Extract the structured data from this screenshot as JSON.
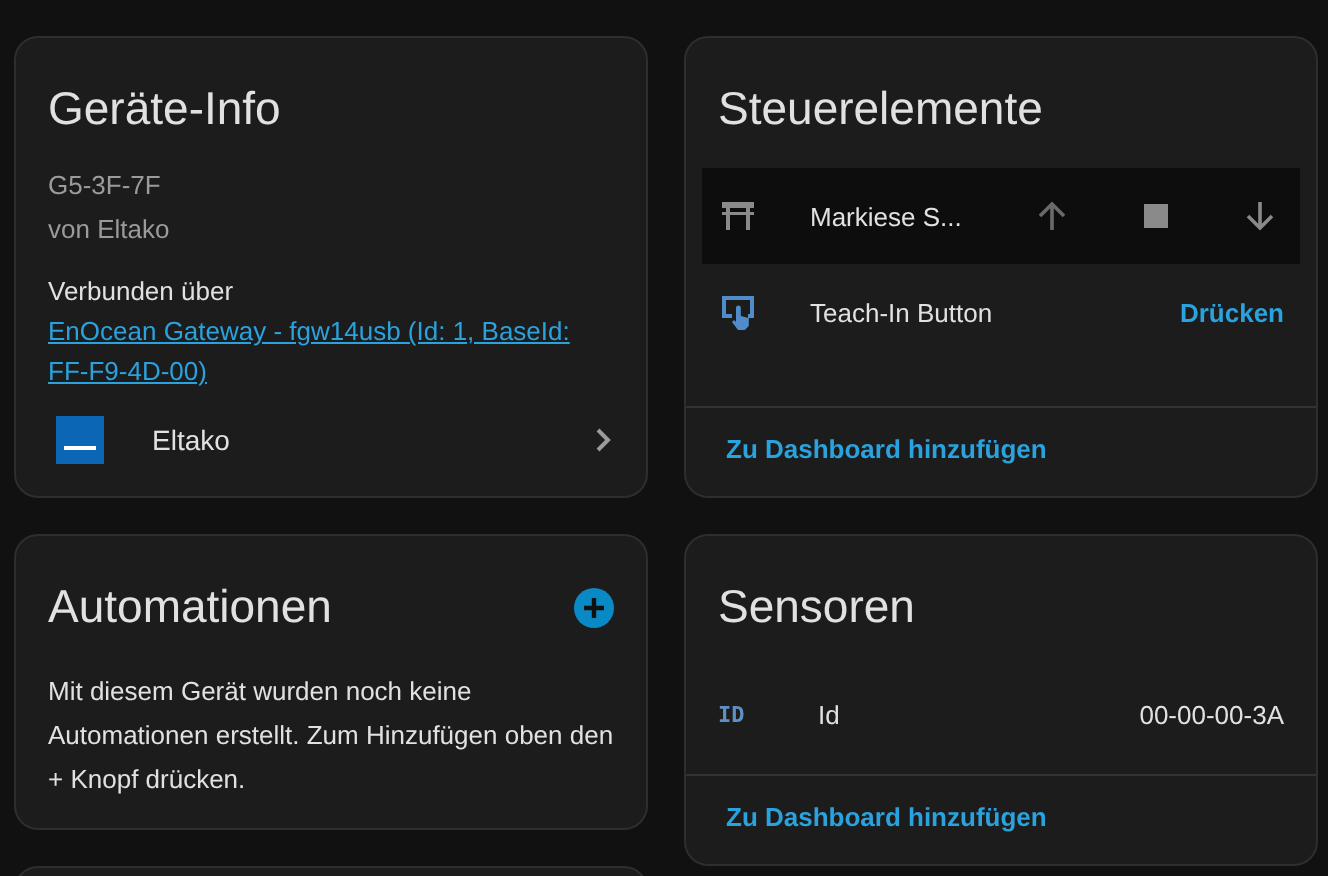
{
  "device_info": {
    "title": "Geräte-Info",
    "model": "G5-3F-7F",
    "manufacturer": "von Eltako",
    "connected_label": "Verbunden über",
    "connected_link": "EnOcean Gateway - fgw14usb (Id: 1, BaseId: FF-F9-4D-00)",
    "integration": "Eltako"
  },
  "automations": {
    "title": "Automationen",
    "text": "Mit diesem Gerät wurden noch keine Automationen erstellt. Zum Hinzufügen oben den + Knopf drücken."
  },
  "controls": {
    "title": "Steuerelemente",
    "entities": [
      {
        "kind": "cover",
        "name": "Markiese S...",
        "highlighted": true
      },
      {
        "kind": "button",
        "name": "Teach-In Button",
        "highlighted": false,
        "action": "Drücken"
      }
    ],
    "footer_link": "Zu Dashboard hinzufügen"
  },
  "sensors": {
    "title": "Sensoren",
    "entities": [
      {
        "icon_text": "ID",
        "name": "Id",
        "value": "00-00-00-3A"
      }
    ],
    "footer_link": "Zu Dashboard hinzufügen"
  }
}
